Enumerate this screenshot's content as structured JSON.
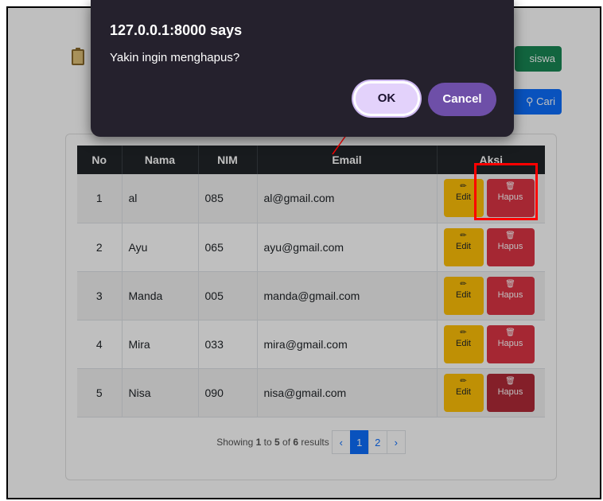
{
  "dialog": {
    "title": "127.0.0.1:8000 says",
    "message": "Yakin ingin menghapus?",
    "ok_label": "OK",
    "cancel_label": "Cancel"
  },
  "header": {
    "tambah_label": "siswa",
    "cari_label": "Cari"
  },
  "table": {
    "columns": [
      "No",
      "Nama",
      "NIM",
      "Email",
      "Aksi"
    ],
    "rows": [
      {
        "no": "1",
        "nama": "al",
        "nim": "085",
        "email": "al@gmail.com"
      },
      {
        "no": "2",
        "nama": "Ayu",
        "nim": "065",
        "email": "ayu@gmail.com"
      },
      {
        "no": "3",
        "nama": "Manda",
        "nim": "005",
        "email": "manda@gmail.com"
      },
      {
        "no": "4",
        "nama": "Mira",
        "nim": "033",
        "email": "mira@gmail.com"
      },
      {
        "no": "5",
        "nama": "Nisa",
        "nim": "090",
        "email": "nisa@gmail.com"
      }
    ],
    "edit_label": "Edit",
    "hapus_label": "Hapus"
  },
  "pagination": {
    "showing_prefix": "Showing",
    "from": "1",
    "to_word": "to",
    "to": "5",
    "of_word": "of",
    "total": "6",
    "results_word": "results",
    "prev": "‹",
    "pages": [
      "1",
      "2"
    ],
    "next": "›"
  },
  "colors": {
    "edit": "#ffc107",
    "hapus": "#dc3545",
    "dialog_bg": "#25212d",
    "ok_bg": "#e3d2fb",
    "cancel_bg": "#6e4fa8",
    "annotation": "#ff0000"
  }
}
